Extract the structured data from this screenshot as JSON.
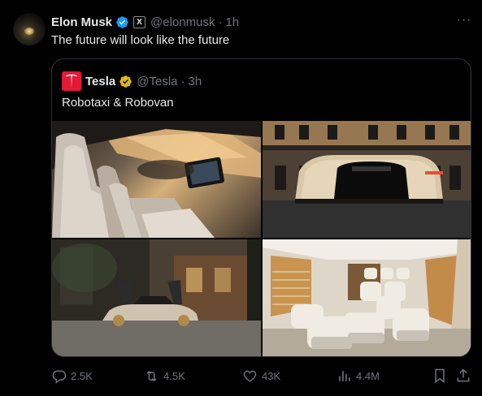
{
  "post": {
    "author_name": "Elon Musk",
    "handle": "@elonmusk",
    "separator": "·",
    "time": "1h",
    "text": "The future will look like the future",
    "more_label": "···",
    "x_badge": "X",
    "verified_icon": "verified-badge-icon"
  },
  "quoted": {
    "author_name": "Tesla",
    "handle": "@Tesla",
    "separator": "·",
    "time": "3h",
    "text": "Robotaxi & Robovan",
    "brand_color": "#e31937",
    "badge_color": "#e2b719"
  },
  "media": [
    {
      "description": "robotaxi-interior"
    },
    {
      "description": "robovan-street"
    },
    {
      "description": "robotaxi-gullwing-doors"
    },
    {
      "description": "robovan-interior"
    }
  ],
  "actions": {
    "replies": "2.5K",
    "reposts": "4.5K",
    "likes": "43K",
    "views": "4.4M"
  },
  "colors": {
    "background": "#000000",
    "text": "#e7e9ea",
    "muted": "#71767b",
    "border": "#2f3336",
    "verified_blue": "#1d9bf0"
  }
}
